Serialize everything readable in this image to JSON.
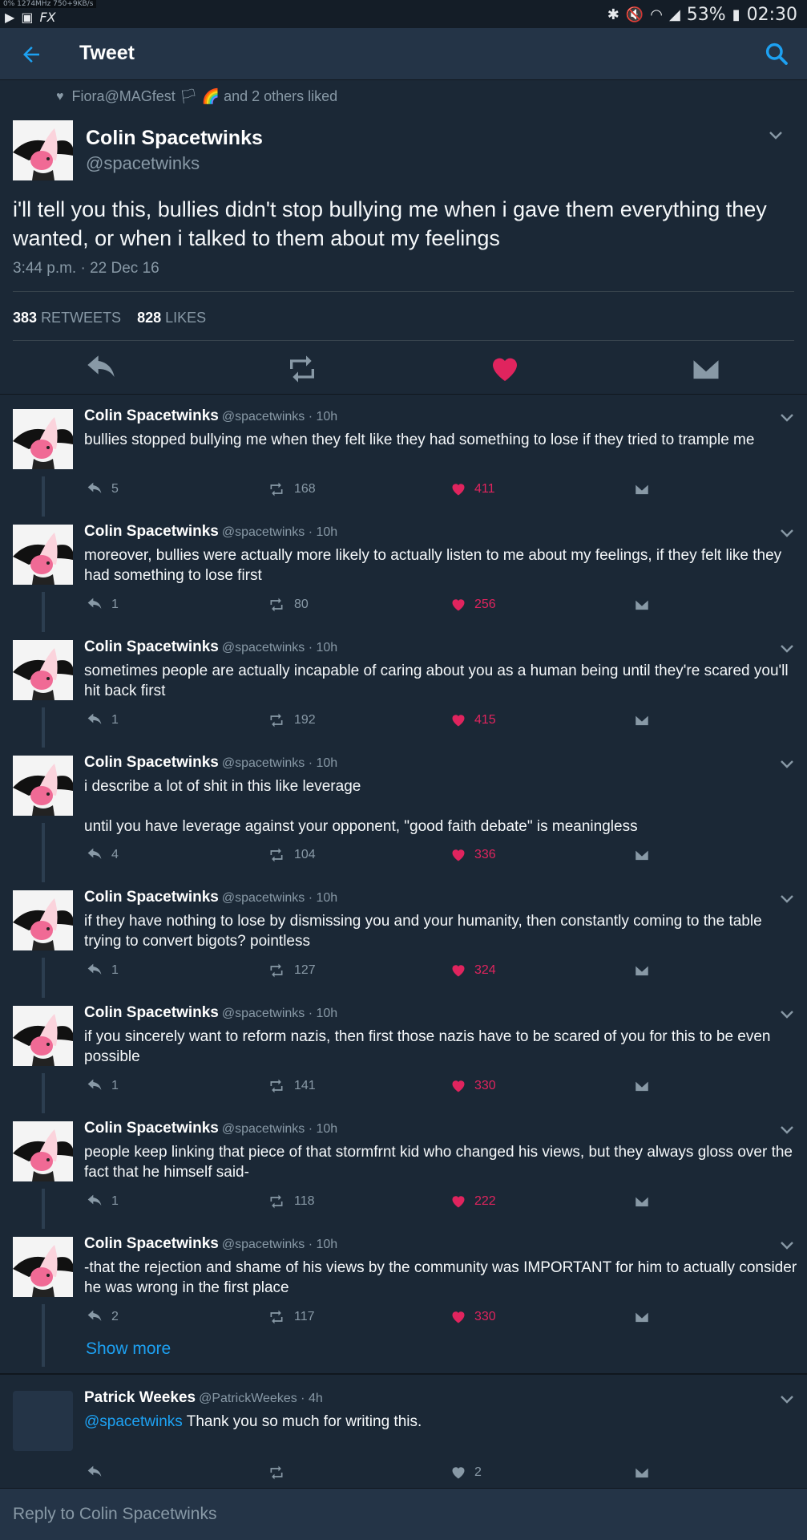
{
  "status_bar": {
    "net": "0%  1274MHz  750+9KB/s",
    "battery": "53%",
    "time": "02:30"
  },
  "app_bar": {
    "title": "Tweet"
  },
  "main_tweet": {
    "liked_by": "Fiora@MAGfest 🏳 🌈 and 2 others liked",
    "name": "Colin Spacetwinks",
    "handle": "@spacetwinks",
    "text": "i'll tell you this, bullies didn't stop bullying me when i gave them everything they wanted, or when i talked to them about my feelings",
    "time": "3:44 p.m. · 22 Dec 16",
    "retweets": "383",
    "retweets_label": "RETWEETS",
    "likes": "828",
    "likes_label": "LIKES"
  },
  "replies": [
    {
      "name": "Colin Spacetwinks",
      "meta": "@spacetwinks · 10h",
      "text": "bullies stopped bullying me when they felt like they had something to lose if they tried to trample me",
      "replies": "5",
      "retweets": "168",
      "likes": "411"
    },
    {
      "name": "Colin Spacetwinks",
      "meta": "@spacetwinks · 10h",
      "text": "moreover, bullies were actually more likely to actually listen to me about my feelings, if they felt like they had something to lose first",
      "replies": "1",
      "retweets": "80",
      "likes": "256"
    },
    {
      "name": "Colin Spacetwinks",
      "meta": "@spacetwinks · 10h",
      "text": "sometimes people are actually incapable of caring about you as a human being until they're scared you'll hit back first",
      "replies": "1",
      "retweets": "192",
      "likes": "415"
    },
    {
      "name": "Colin Spacetwinks",
      "meta": "@spacetwinks · 10h",
      "text": "i describe a lot of shit in this like leverage",
      "text2": "until you have leverage against your opponent, \"good faith debate\" is meaningless",
      "replies": "4",
      "retweets": "104",
      "likes": "336"
    },
    {
      "name": "Colin Spacetwinks",
      "meta": "@spacetwinks · 10h",
      "text": "if they have nothing to lose by dismissing you and your humanity, then constantly coming to the table trying to convert bigots? pointless",
      "replies": "1",
      "retweets": "127",
      "likes": "324"
    },
    {
      "name": "Colin Spacetwinks",
      "meta": "@spacetwinks · 10h",
      "text": "if you sincerely want to reform nazis, then first those nazis have to be scared of you for this to be even possible",
      "replies": "1",
      "retweets": "141",
      "likes": "330"
    },
    {
      "name": "Colin Spacetwinks",
      "meta": "@spacetwinks · 10h",
      "text": "people keep linking that piece of that stormfrnt kid who changed his views, but they always gloss over the fact that he himself said-",
      "replies": "1",
      "retweets": "118",
      "likes": "222"
    },
    {
      "name": "Colin Spacetwinks",
      "meta": "@spacetwinks · 10h",
      "text": "-that the rejection and shame of his views by the community was IMPORTANT for him to actually consider he was wrong in the first place",
      "replies": "2",
      "retweets": "117",
      "likes": "330"
    }
  ],
  "show_more": "Show more",
  "other_reply": {
    "name": "Patrick Weekes",
    "meta": "@PatrickWeekes · 4h",
    "mention": "@spacetwinks",
    "text": " Thank you so much for writing this.",
    "likes": "2"
  },
  "reply_bar": {
    "placeholder": "Reply to Colin Spacetwinks"
  },
  "colors": {
    "accent": "#1da1f2",
    "like": "#e0245e",
    "bg": "#1b2836",
    "bar": "#243447"
  }
}
